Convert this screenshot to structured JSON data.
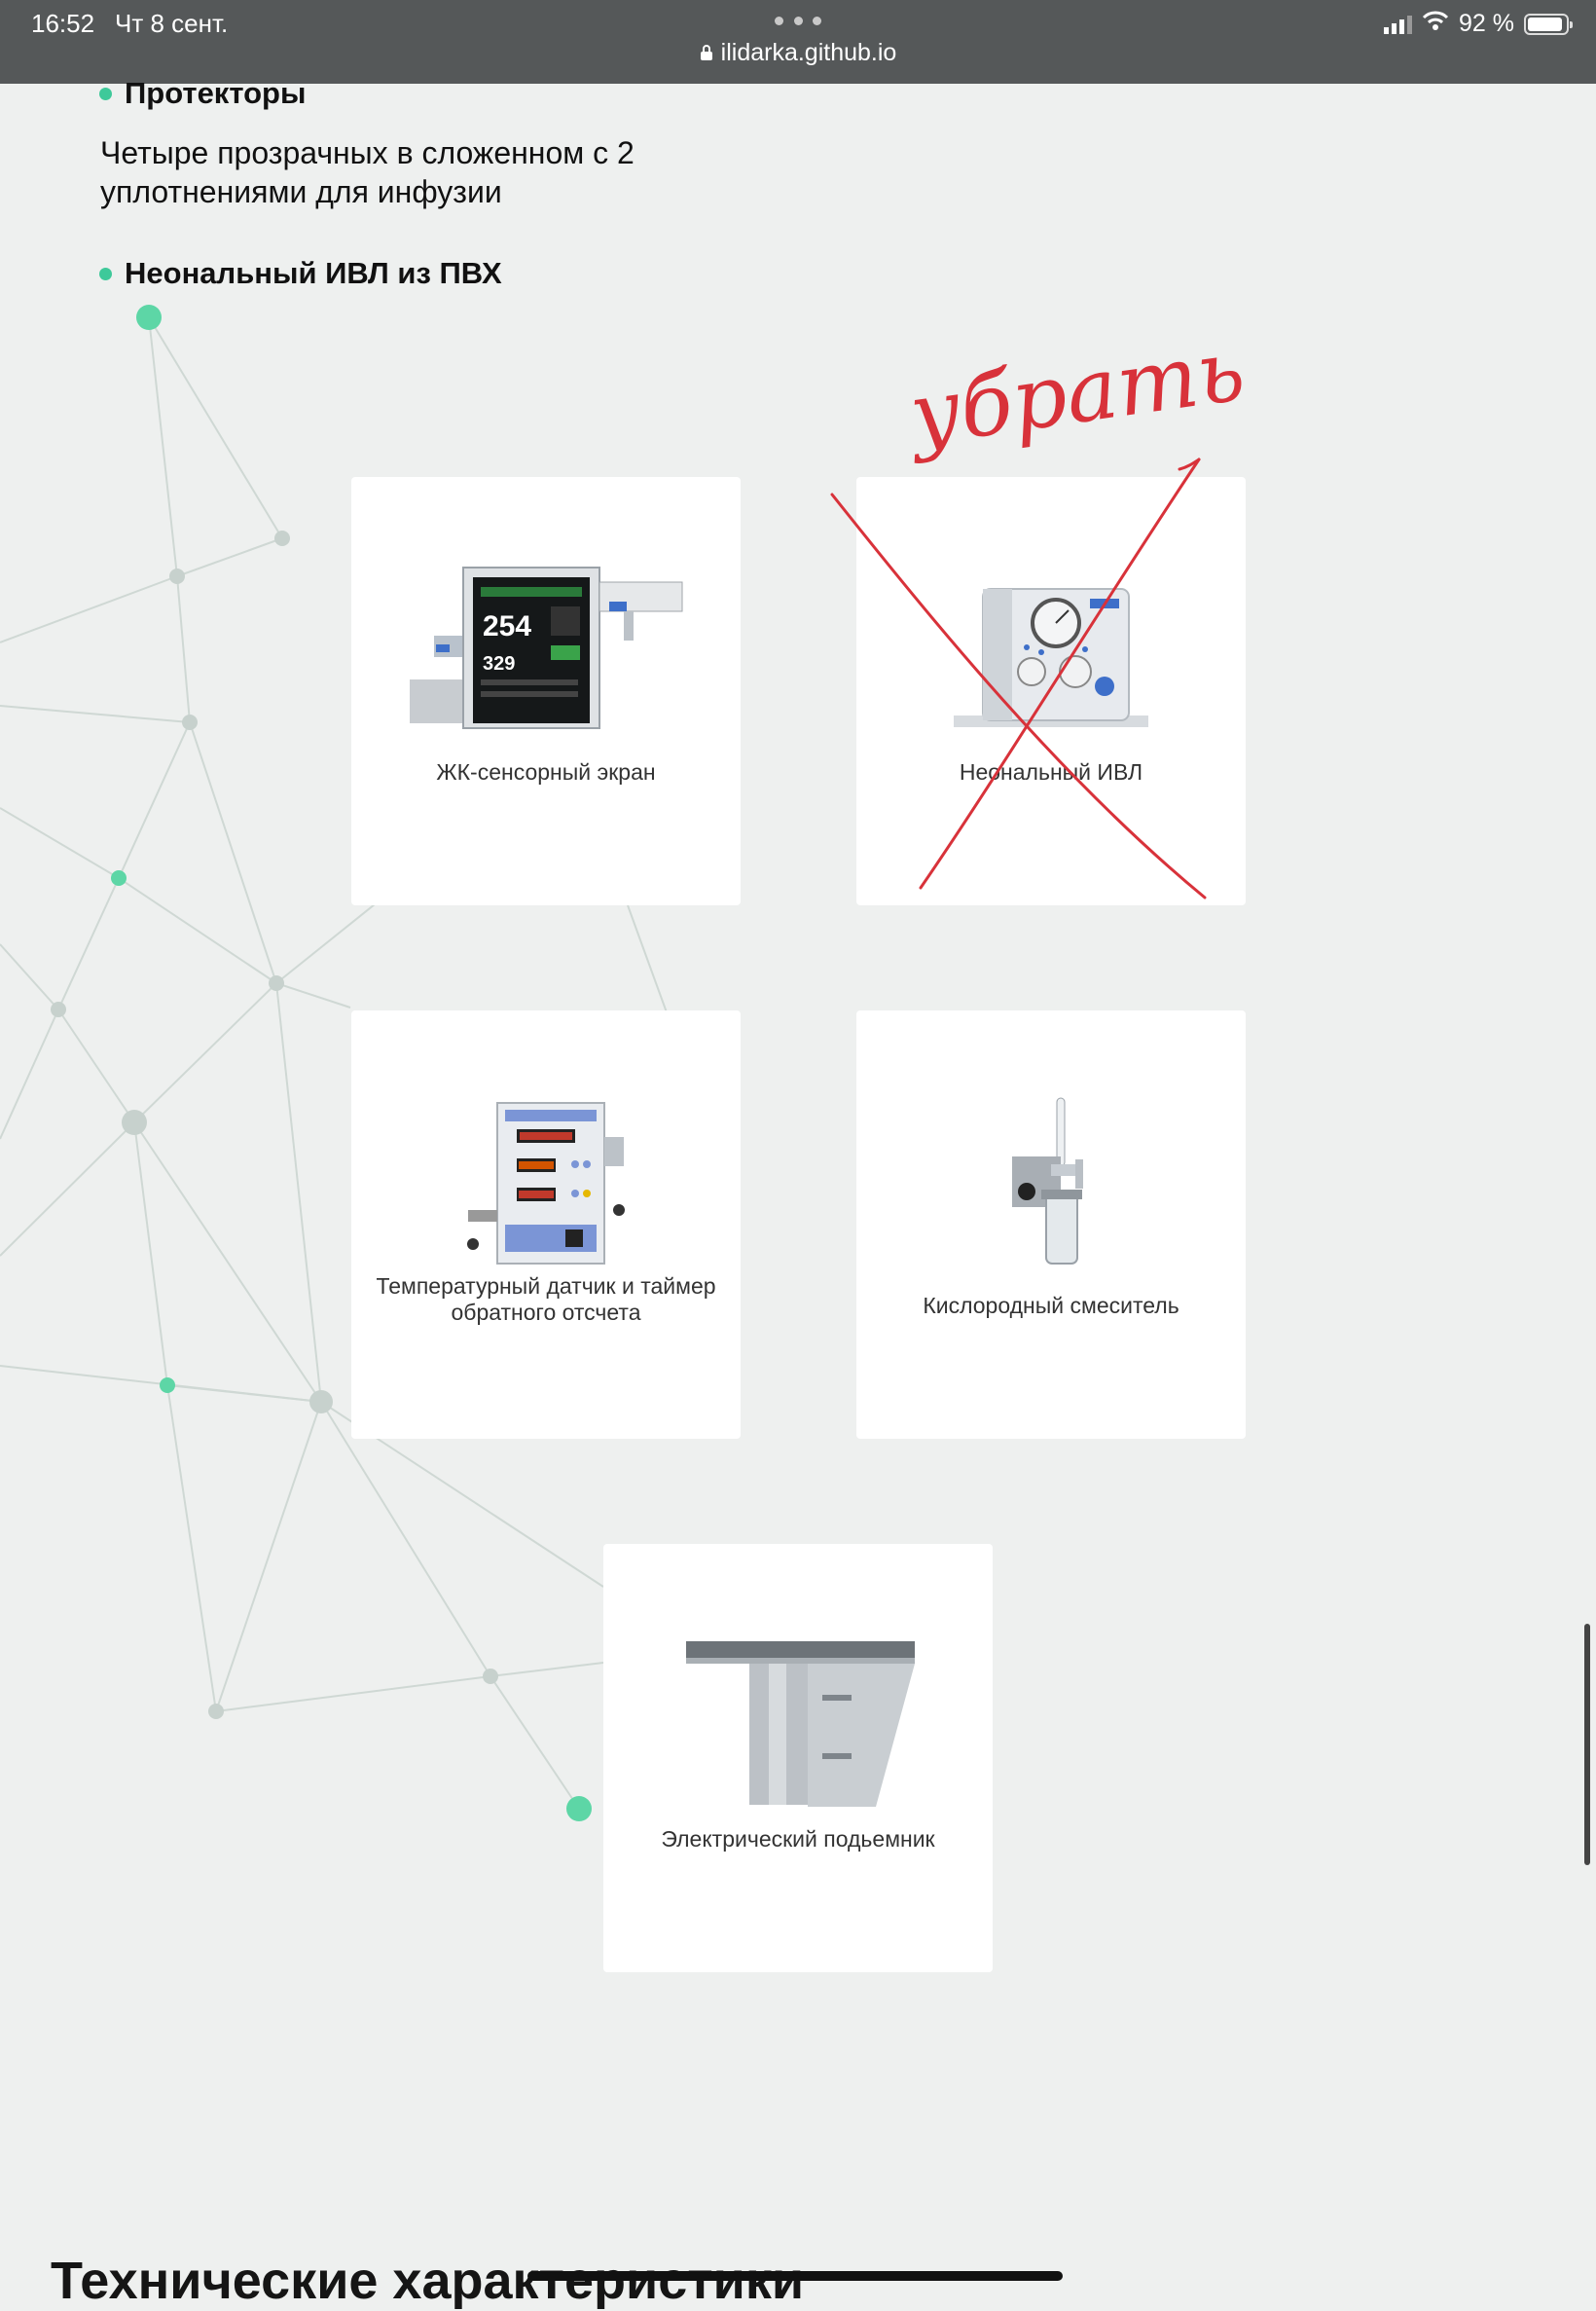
{
  "status": {
    "time": "16:52",
    "date": "Чт 8 сент.",
    "url": "ilidarka.github.io",
    "battery": "92 %"
  },
  "content": {
    "bullet1": "Протекторы",
    "desc1": "Четыре прозрачных в сложенном с 2 уплотнениями для инфузии",
    "bullet2": "Неональный ИВЛ из ПВХ",
    "cards": [
      {
        "caption": "ЖК-сенсорный экран"
      },
      {
        "caption": "Неональный ИВЛ"
      },
      {
        "caption": "Температурный датчик и таймер обратного отсчета"
      },
      {
        "caption": "Кислородный смеситель"
      },
      {
        "caption": "Электрический подьемник"
      }
    ],
    "section_heading": "Технические характеристики"
  },
  "annotation": {
    "handwritten_note": "убрать",
    "strike_color": "#d8323a"
  },
  "colors": {
    "accent": "#3ec99a",
    "background": "#eef0ef"
  }
}
